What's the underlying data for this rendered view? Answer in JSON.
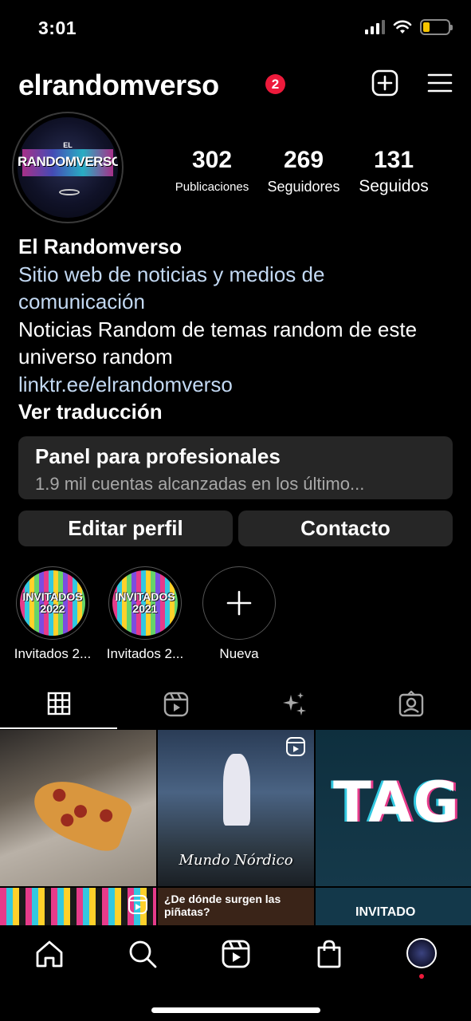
{
  "status_bar": {
    "time": "3:01"
  },
  "header": {
    "username": "elrandomverso",
    "notification_count": "2"
  },
  "profile": {
    "avatar_small_text": "EL",
    "avatar_logo_text": "RANDOMVERSO",
    "stats": [
      {
        "value": "302",
        "label": "Publicaciones"
      },
      {
        "value": "269",
        "label": "Seguidores"
      },
      {
        "value": "131",
        "label": "Seguidos"
      }
    ],
    "name": "El Randomverso",
    "category": "Sitio web de noticias y medios de comunicación",
    "bio": "Noticias Random de temas random de este universo random",
    "link": "linktr.ee/elrandomverso",
    "translate": "Ver traducción"
  },
  "dashboard": {
    "title": "Panel para profesionales",
    "subtitle": "1.9 mil cuentas alcanzadas en los último..."
  },
  "actions": {
    "edit": "Editar perfil",
    "contact": "Contacto"
  },
  "highlights": [
    {
      "label": "Invitados 2...",
      "cover_text": "INVITADOS 2022"
    },
    {
      "label": "Invitados 2...",
      "cover_text": "INVITADOS 2021"
    },
    {
      "label": "Nueva"
    }
  ],
  "tabs": [
    {
      "icon": "grid-icon",
      "active": true
    },
    {
      "icon": "reels-icon",
      "active": false
    },
    {
      "icon": "sparkles-icon",
      "active": false
    },
    {
      "icon": "tagged-icon",
      "active": false
    }
  ],
  "grid_posts": {
    "post2_caption": "Mundo Nórdico",
    "post3_text": "TAG",
    "post5_text": "¿De dónde surgen las piñatas?",
    "post6_text": "INVITADO"
  },
  "bottom_nav": [
    "home-icon",
    "search-icon",
    "reels-icon",
    "shop-icon",
    "profile-avatar"
  ],
  "colors": {
    "background": "#000000",
    "badge": "#ed1a3b",
    "link": "#c3d9f3",
    "button_bg": "#262626"
  }
}
